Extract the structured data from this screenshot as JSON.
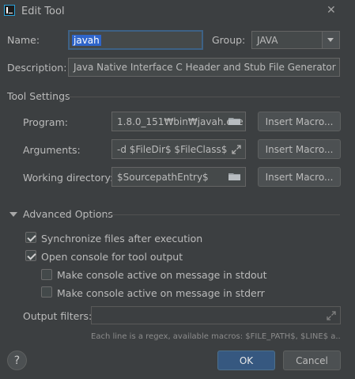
{
  "window": {
    "title": "Edit Tool",
    "close_glyph": "✕"
  },
  "form": {
    "name_label": "Name:",
    "name_value": "javah",
    "group_label": "Group:",
    "group_value": "JAVA",
    "description_label": "Description:",
    "description_value": "Java Native Interface C Header and Stub File Generator"
  },
  "tool_settings": {
    "title": "Tool Settings",
    "program_label": "Program:",
    "program_value": "1.8.0_151₩bin₩javah.exe",
    "arguments_label": "Arguments:",
    "arguments_value": "-d $FileDir$ $FileClass$",
    "workdir_label": "Working directory:",
    "workdir_value": "$SourcepathEntry$",
    "insert_macro_label": "Insert Macro..."
  },
  "advanced": {
    "title": "Advanced Options",
    "options": [
      {
        "label": "Synchronize files after execution",
        "checked": true
      },
      {
        "label": "Open console for tool output",
        "checked": true
      },
      {
        "label": "Make console active on message in stdout",
        "checked": false
      },
      {
        "label": "Make console active on message in stderr",
        "checked": false
      }
    ],
    "output_filters_label": "Output filters:",
    "output_filters_value": "",
    "hint": "Each line is a regex, available macros: $FILE_PATH$, $LINE$ a..."
  },
  "footer": {
    "help_glyph": "?",
    "ok_label": "OK",
    "cancel_label": "Cancel"
  },
  "colors": {
    "background": "#3c3f41",
    "accent": "#365880",
    "selection": "#2f65ca",
    "focus_border": "#3d6185"
  }
}
